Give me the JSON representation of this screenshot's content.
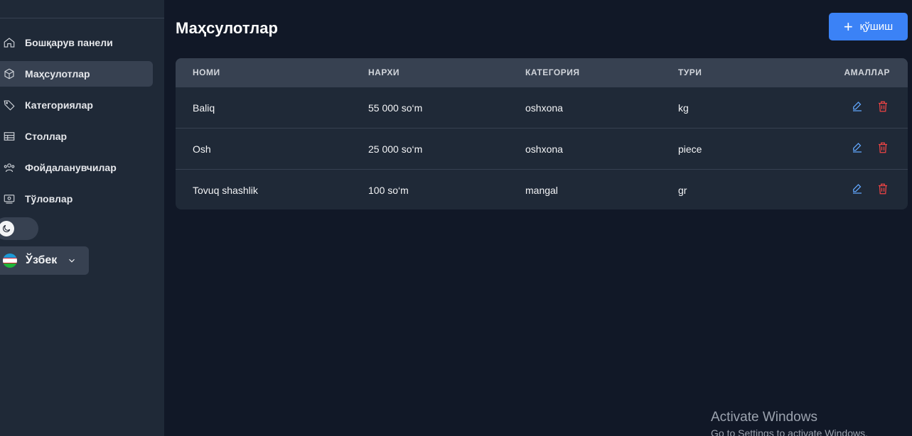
{
  "sidebar": {
    "items": [
      {
        "label": "Бошқарув панели",
        "icon": "home-icon",
        "active": false
      },
      {
        "label": "Маҳсулотлар",
        "icon": "box-icon",
        "active": true
      },
      {
        "label": "Категориялар",
        "icon": "tag-icon",
        "active": false
      },
      {
        "label": "Столлар",
        "icon": "table-icon",
        "active": false
      },
      {
        "label": "Фойдаланувчилар",
        "icon": "users-icon",
        "active": false
      },
      {
        "label": "Тўловлар",
        "icon": "payment-icon",
        "active": false
      }
    ],
    "theme_icon": "moon-icon",
    "language": {
      "selected": "Ўзбек",
      "icon": "uzbekistan-flag-icon"
    }
  },
  "main": {
    "title": "Маҳсулотлар",
    "add_button": {
      "label": "қўшиш",
      "icon": "plus-icon"
    },
    "table": {
      "headers": [
        "НОМИ",
        "НАРХИ",
        "КАТЕГОРИЯ",
        "ТУРИ",
        "АМАЛЛАР"
      ],
      "rows": [
        {
          "name": "Baliq",
          "price": "55 000 so‘m",
          "category": "oshxona",
          "type": "kg"
        },
        {
          "name": "Osh",
          "price": "25 000 so‘m",
          "category": "oshxona",
          "type": "piece"
        },
        {
          "name": "Tovuq shashlik",
          "price": "100 so‘m",
          "category": "mangal",
          "type": "gr"
        }
      ]
    }
  },
  "watermark": {
    "line1": "Activate Windows",
    "line2": "Go to Settings to activate Windows."
  },
  "colors": {
    "accent": "#3b82f6",
    "edit": "#60a5fa",
    "delete": "#ef4444",
    "background": "#111827",
    "sidebar": "#1f2937"
  }
}
